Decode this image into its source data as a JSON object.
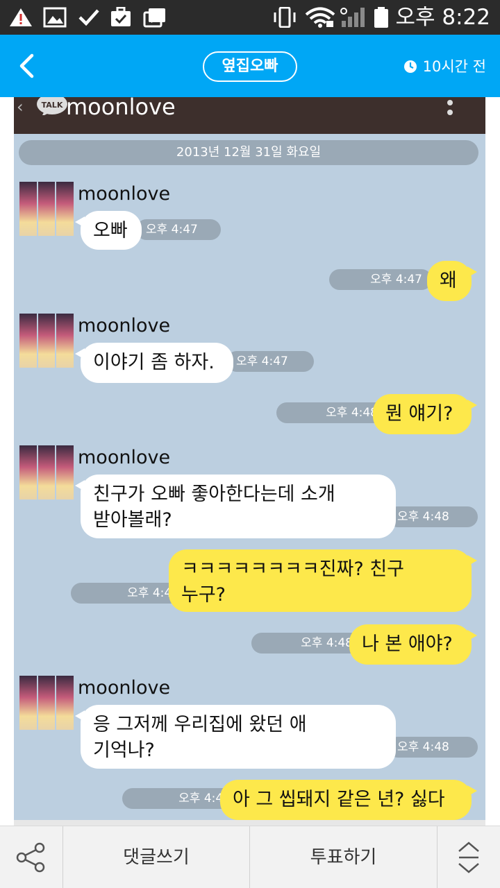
{
  "status_bar": {
    "time": "오후 8:22",
    "icons": [
      "warning-icon",
      "gallery-icon",
      "check-icon",
      "briefcase-check-icon",
      "media-share-icon",
      "vibrate-icon",
      "wifi-icon",
      "signal-icon",
      "battery-icon"
    ]
  },
  "header": {
    "title": "옆집오빠",
    "time_ago": "10시간 전",
    "accent": "#00a7f5"
  },
  "chat": {
    "app_title": "moonlove",
    "date": "2013년 12월 31일 화요일",
    "messages": [
      {
        "side": "in",
        "sender": "moonlove",
        "lines": [
          "오빠"
        ],
        "time": "오후 4:47"
      },
      {
        "side": "out",
        "lines": [
          "왜"
        ],
        "time": "오후 4:47"
      },
      {
        "side": "in",
        "sender": "moonlove",
        "lines": [
          "이야기 좀 하자."
        ],
        "time": "오후 4:47"
      },
      {
        "side": "out",
        "lines": [
          "뭔 얘기?"
        ],
        "time": "오후 4:48"
      },
      {
        "side": "in",
        "sender": "moonlove",
        "lines": [
          "친구가 오빠 좋아한다는데 소개",
          "받아볼래?"
        ],
        "time": "오후 4:48"
      },
      {
        "side": "out",
        "lines": [
          "ㅋㅋㅋㅋㅋㅋㅋㅋ진짜? 친구",
          "누구?"
        ],
        "time": "오후 4:48"
      },
      {
        "side": "out",
        "lines": [
          "나 본 애야?"
        ],
        "time": "오후 4:48"
      },
      {
        "side": "in",
        "sender": "moonlove",
        "lines": [
          "응 그저께 우리집에 왔던 애",
          "기억나?"
        ],
        "time": "오후 4:48"
      },
      {
        "side": "out",
        "lines": [
          "아 그 씹돼지 같은 년? 싫다"
        ],
        "time": "오후 4:48"
      }
    ],
    "colors": {
      "background": "#bccfe0",
      "incoming": "#ffffff",
      "outgoing": "#fde84b",
      "timestamp": "#9aa9b6"
    }
  },
  "bottom_bar": {
    "comment_label": "댓글쓰기",
    "vote_label": "투표하기"
  }
}
